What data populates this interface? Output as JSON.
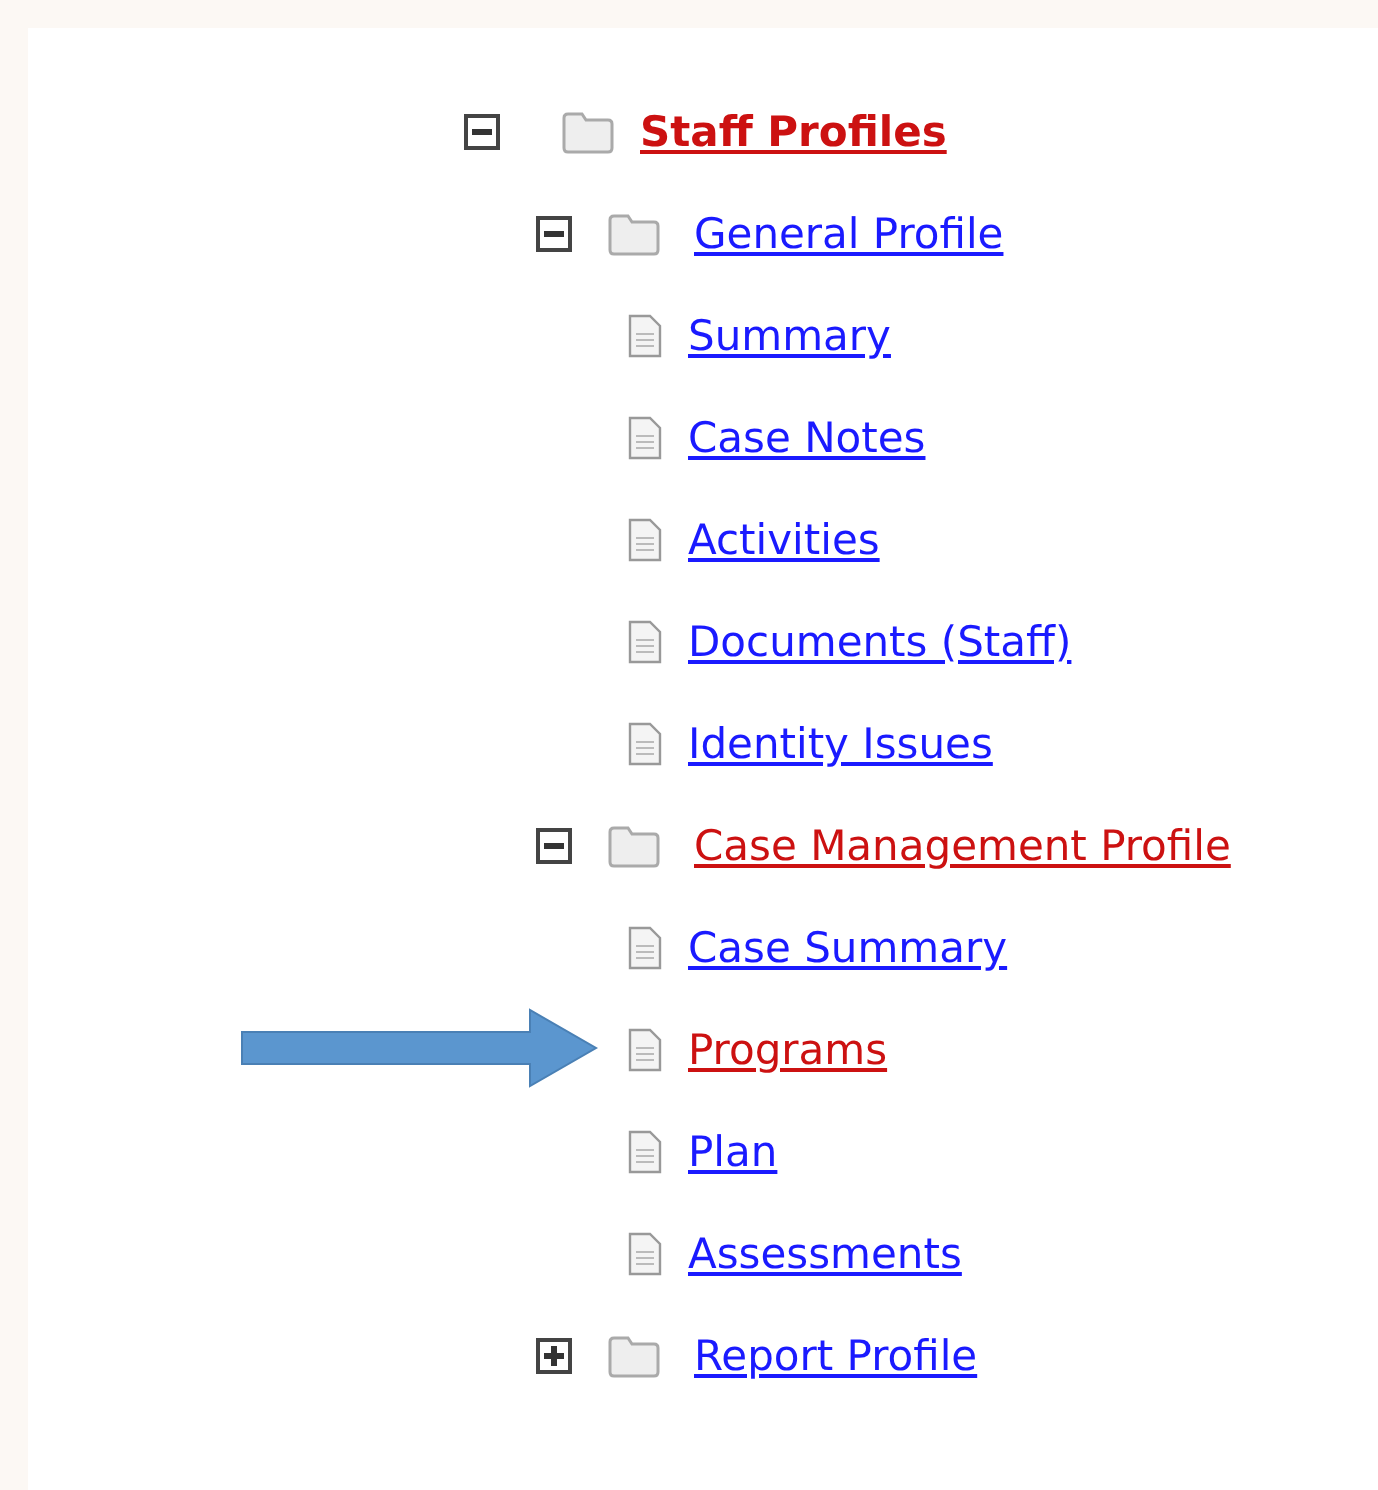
{
  "tree": {
    "label": "Staff Profiles",
    "kind": "folder",
    "expanded": true,
    "selected": true,
    "children": [
      {
        "label": "General Profile",
        "kind": "folder",
        "expanded": true,
        "selected": false,
        "children": [
          {
            "label": "Summary",
            "kind": "page",
            "selected": false,
            "pointed": false
          },
          {
            "label": "Case Notes",
            "kind": "page",
            "selected": false,
            "pointed": false
          },
          {
            "label": "Activities",
            "kind": "page",
            "selected": false,
            "pointed": false
          },
          {
            "label": "Documents (Staff)",
            "kind": "page",
            "selected": false,
            "pointed": false
          },
          {
            "label": "Identity Issues",
            "kind": "page",
            "selected": false,
            "pointed": false
          }
        ]
      },
      {
        "label": "Case Management Profile",
        "kind": "folder",
        "expanded": true,
        "selected": true,
        "children": [
          {
            "label": "Case Summary",
            "kind": "page",
            "selected": false,
            "pointed": false
          },
          {
            "label": "Programs",
            "kind": "page",
            "selected": true,
            "pointed": true
          },
          {
            "label": "Plan",
            "kind": "page",
            "selected": false,
            "pointed": false
          },
          {
            "label": "Assessments",
            "kind": "page",
            "selected": false,
            "pointed": false
          }
        ]
      },
      {
        "label": "Report Profile",
        "kind": "folder",
        "expanded": false,
        "selected": false
      }
    ]
  }
}
